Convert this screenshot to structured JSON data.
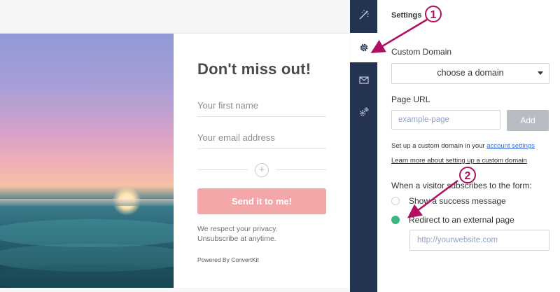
{
  "form": {
    "headline": "Don't miss out!",
    "first_name_placeholder": "Your first name",
    "email_placeholder": "Your email address",
    "add_field_symbol": "+",
    "submit_label": "Send it to me!",
    "privacy_line1": "We respect your privacy.",
    "privacy_line2": "Unsubscribe at anytime.",
    "powered_by": "Powered By ConvertKit"
  },
  "rail": {
    "items": [
      {
        "icon": "magic-wand-icon",
        "active": false
      },
      {
        "icon": "gear-icon",
        "active": true
      },
      {
        "icon": "mail-icon",
        "active": false
      },
      {
        "icon": "gears-icon",
        "active": false
      }
    ]
  },
  "settings": {
    "title": "Settings",
    "custom_domain_label": "Custom Domain",
    "domain_select_value": "choose a domain",
    "page_url_label": "Page URL",
    "page_url_placeholder": "example-page",
    "add_label": "Add",
    "help_text": "Set up a custom domain in your",
    "help_link": "account settings",
    "learn_more": "Learn more about setting up a custom domain",
    "subscribe_label": "When a visitor subscribes to the form:",
    "option_success": "Show a success message",
    "option_redirect": "Redirect to an external page",
    "redirect_placeholder": "http://yourwebsite.com",
    "selected_option": "redirect"
  },
  "annotations": {
    "badge_1": "1",
    "badge_2": "2"
  },
  "colors": {
    "rail_bg": "#253352",
    "submit_bg": "#f4a7a9",
    "radio_checked": "#3db782",
    "annotation": "#b0105f",
    "link": "#3a6fd8"
  }
}
